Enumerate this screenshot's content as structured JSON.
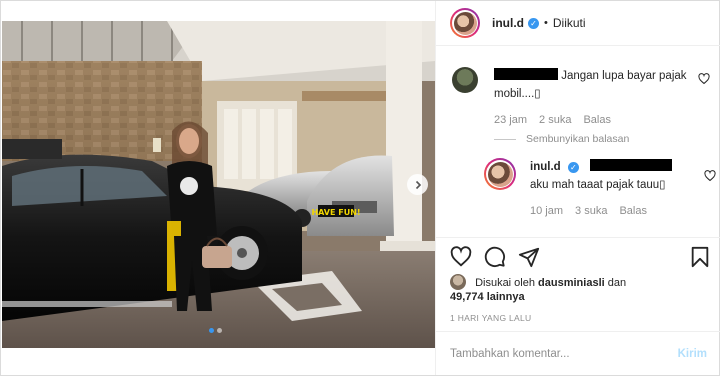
{
  "post": {
    "username": "inul.d",
    "separator": "•",
    "follow_state": "Diikuti"
  },
  "comments": [
    {
      "text": "Jangan lupa bayar pajak mobil....▯",
      "time": "23 jam",
      "likes": "2 suka",
      "reply": "Balas"
    }
  ],
  "hide_replies": "Sembunyikan balasan",
  "reply": {
    "username": "inul.d",
    "text_after_redact": "aku mah taaat pajak tauu▯",
    "time": "10 jam",
    "likes": "3 suka",
    "reply": "Balas"
  },
  "likes_line": {
    "prefix": "Disukai oleh",
    "user": "dausminiasli",
    "conj": "dan",
    "count": "49,774 lainnya"
  },
  "posted_ago": "1 HARI YANG LALU",
  "composer": {
    "placeholder": "Tambahkan komentar...",
    "post_label": "Kirim"
  },
  "photo": {
    "plate_text": "HAVE FUN!",
    "slide_index": 1,
    "slide_count": 2
  },
  "icons": [
    "chevron-right-icon",
    "heart-icon",
    "comment-icon",
    "share-icon",
    "bookmark-icon",
    "verified-icon"
  ],
  "colors": {
    "accent": "#3897f0",
    "post_disabled": "#b2dffc",
    "muted": "#8e8e8e"
  }
}
